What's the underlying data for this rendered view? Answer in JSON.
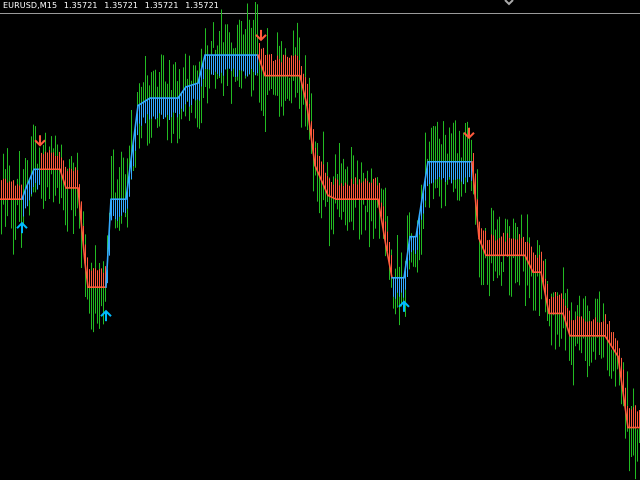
{
  "header": {
    "symbol_tf": "EURUSD,M15",
    "ohlc": [
      "1.35721",
      "1.35721",
      "1.35721",
      "1.35721"
    ]
  },
  "colors": {
    "background": "#000000",
    "bars": "#22bb22",
    "trend_up": "#33aaff",
    "trend_down": "#ff5a3c",
    "arrow_up": "#00bbff",
    "arrow_down": "#ff5a3c",
    "top_line": "#9a9a9a"
  },
  "chart_data": {
    "type": "line",
    "series": [
      {
        "values": [
          [
            0,
            1.355
          ],
          [
            22,
            1.355
          ],
          [
            26,
            1.3556
          ],
          [
            34,
            1.3566
          ],
          [
            40,
            1.3566
          ],
          [
            60,
            1.3566
          ],
          [
            66,
            1.3556
          ],
          [
            78,
            1.3556
          ],
          [
            85,
            1.3516
          ],
          [
            88,
            1.3503
          ],
          [
            106,
            1.3503
          ],
          [
            111,
            1.355
          ],
          [
            126,
            1.355
          ],
          [
            138,
            1.36
          ],
          [
            150,
            1.3604
          ],
          [
            178,
            1.3604
          ],
          [
            186,
            1.361
          ],
          [
            198,
            1.3612
          ],
          [
            205,
            1.3627
          ],
          [
            212,
            1.3627
          ],
          [
            258,
            1.3627
          ],
          [
            265,
            1.3616
          ],
          [
            272,
            1.3616
          ],
          [
            300,
            1.3616
          ],
          [
            307,
            1.36
          ],
          [
            315,
            1.3568
          ],
          [
            328,
            1.3552
          ],
          [
            336,
            1.355
          ],
          [
            378,
            1.355
          ],
          [
            386,
            1.3525
          ],
          [
            392,
            1.3508
          ],
          [
            404,
            1.3508
          ],
          [
            410,
            1.353
          ],
          [
            416,
            1.353
          ],
          [
            428,
            1.357
          ],
          [
            472,
            1.357
          ],
          [
            479,
            1.3529
          ],
          [
            486,
            1.352
          ],
          [
            500,
            1.352
          ],
          [
            525,
            1.352
          ],
          [
            533,
            1.3511
          ],
          [
            541,
            1.3511
          ],
          [
            549,
            1.3489
          ],
          [
            563,
            1.3489
          ],
          [
            570,
            1.3477
          ],
          [
            605,
            1.3477
          ],
          [
            618,
            1.3466
          ],
          [
            628,
            1.3428
          ],
          [
            639,
            1.3428
          ]
        ]
      }
    ],
    "up_segments": [
      [
        22,
        40
      ],
      [
        106,
        258
      ],
      [
        392,
        472
      ]
    ],
    "signals": [
      {
        "type": "up",
        "x": 22
      },
      {
        "type": "down",
        "x": 40
      },
      {
        "type": "up",
        "x": 106
      },
      {
        "type": "down",
        "x": 261
      },
      {
        "type": "up",
        "x": 404
      },
      {
        "type": "down",
        "x": 469
      }
    ],
    "ylim": [
      1.34,
      1.365
    ],
    "xlim": [
      0,
      640
    ],
    "grid": false
  }
}
